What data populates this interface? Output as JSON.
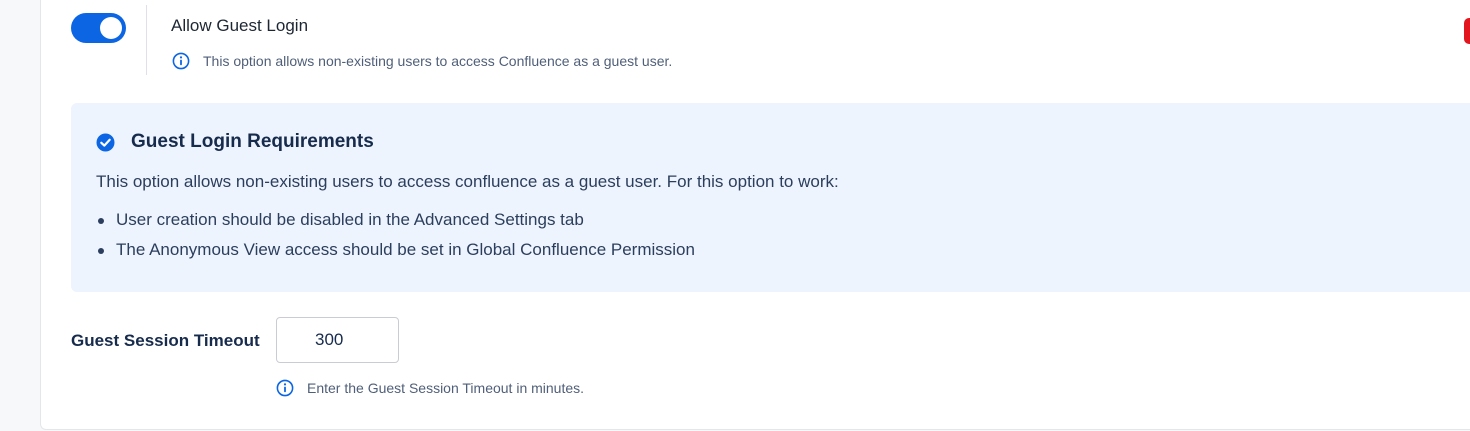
{
  "guest_login": {
    "toggle_on": true,
    "title": "Allow Guest Login",
    "description": "This option allows non-existing users to access Confluence as a guest user."
  },
  "requirements": {
    "title": "Guest Login Requirements",
    "intro": "This option allows non-existing users to access confluence as a guest user. For this option to work:",
    "items": [
      "User creation should be disabled in the Advanced Settings tab",
      "The Anonymous View access should be set in Global Confluence Permission"
    ]
  },
  "session_timeout": {
    "label": "Guest Session Timeout",
    "value": "300",
    "hint": "Enter the Guest Session Timeout in minutes."
  },
  "colors": {
    "accent": "#0C66E4",
    "info_box_bg": "#EDF4FE",
    "edge_tab": "#E2161F"
  },
  "icons": {
    "info": "info-circle-icon",
    "check": "check-circle-icon"
  }
}
